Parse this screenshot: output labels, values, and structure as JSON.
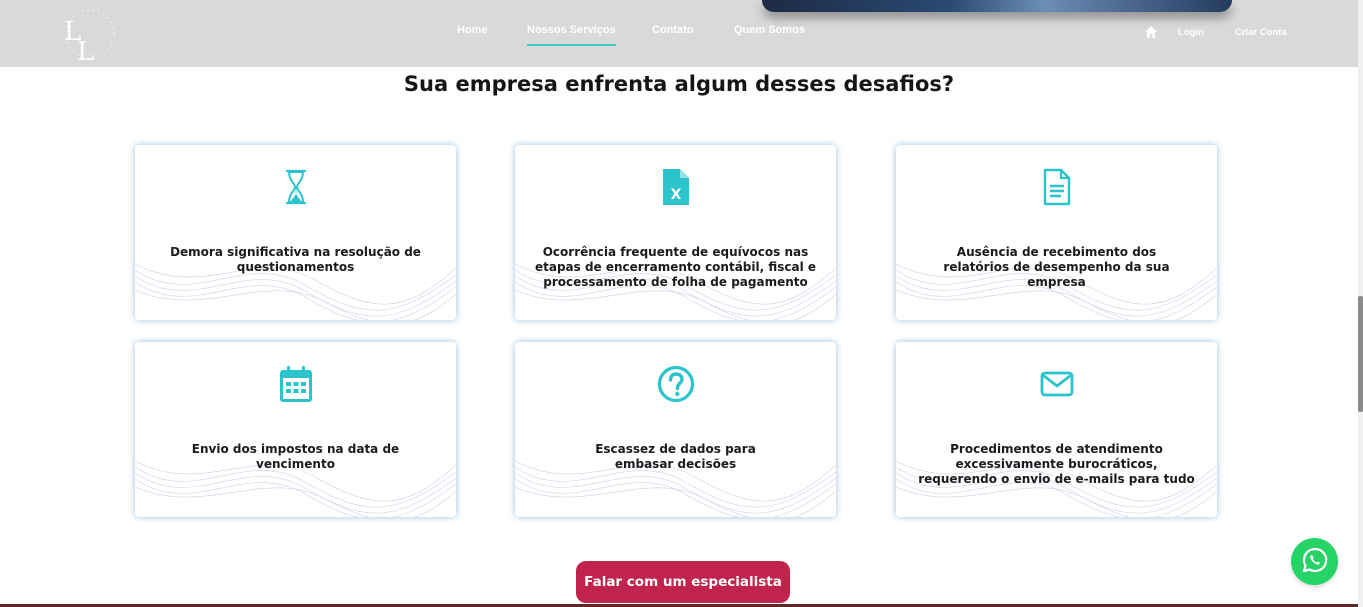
{
  "brand": {
    "logo_text": "LL"
  },
  "nav": {
    "links": [
      {
        "label": "Home",
        "active": false
      },
      {
        "label": "Nossos Serviços",
        "active": true
      },
      {
        "label": "Contato",
        "active": false
      },
      {
        "label": "Quem Somos",
        "active": false
      }
    ],
    "login_label": "Login",
    "signup_label": "Criar Conta"
  },
  "section": {
    "title": "Sua empresa enfrenta algum desses desafios?"
  },
  "cards": [
    {
      "icon": "hourglass-icon",
      "text": "Demora significativa na resolução de questionamentos"
    },
    {
      "icon": "excel-file-icon",
      "text": "Ocorrência frequente de equívocos nas etapas de encerramento contábil, fiscal e processamento de folha de pagamento"
    },
    {
      "icon": "document-icon",
      "text": "Ausência de recebimento dos relatórios de desempenho da sua empresa"
    },
    {
      "icon": "calendar-icon",
      "text": "Envio dos impostos na data de vencimento"
    },
    {
      "icon": "question-circle-icon",
      "text": "Escassez de dados para embasar decisões"
    },
    {
      "icon": "envelope-icon",
      "text": "Procedimentos de atendimento excessivamente burocráticos, requerendo o envio de e-mails para tudo"
    }
  ],
  "cta": {
    "label": "Falar com um especialista"
  },
  "colors": {
    "accent": "#3cc7c9",
    "icon": "#2bc3cc",
    "cta": "#c0244d",
    "navbar": "#d9d9d9",
    "whatsapp": "#25d366"
  }
}
